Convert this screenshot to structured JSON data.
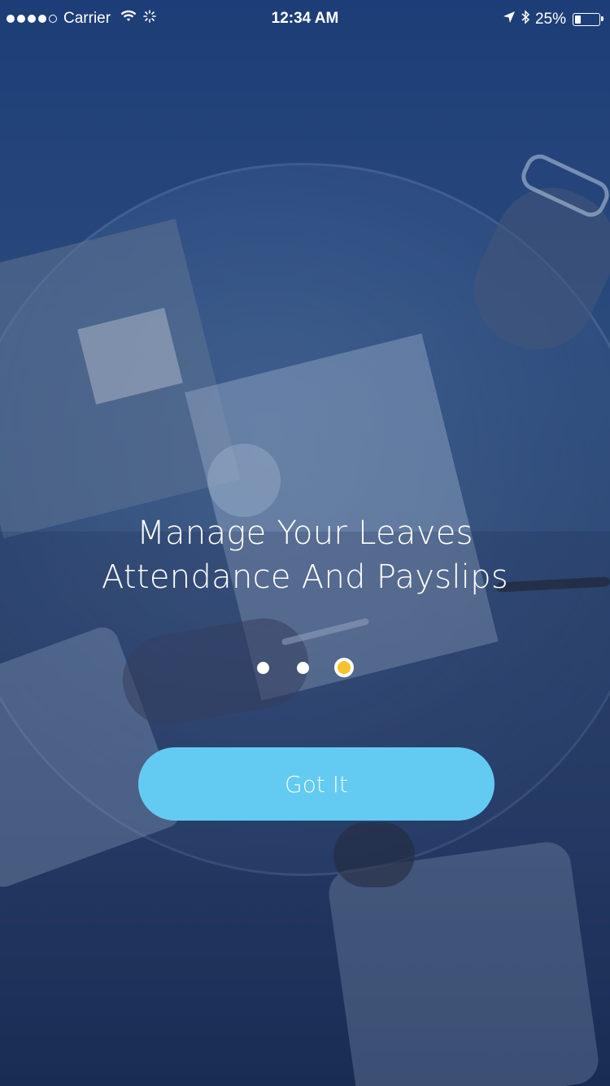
{
  "status_bar": {
    "carrier": "Carrier",
    "time": "12:34 AM",
    "battery_percent": "25%",
    "battery_level": 0.25
  },
  "onboarding": {
    "headline_line1": "Manage Your Leaves",
    "headline_line2": "Attendance And Payslips",
    "cta_label": "Got It",
    "page_count": 3,
    "active_page": 3
  },
  "colors": {
    "cta_background": "#63cbf1",
    "active_dot": "#f6c32c",
    "inactive_dot": "#ffffff",
    "background_tint": "#1f3a6b"
  },
  "icons": {
    "signal": "cellular-signal-icon",
    "wifi": "wifi-icon",
    "activity": "network-activity-icon",
    "location": "location-arrow-icon",
    "bluetooth": "bluetooth-icon",
    "battery": "battery-icon"
  }
}
